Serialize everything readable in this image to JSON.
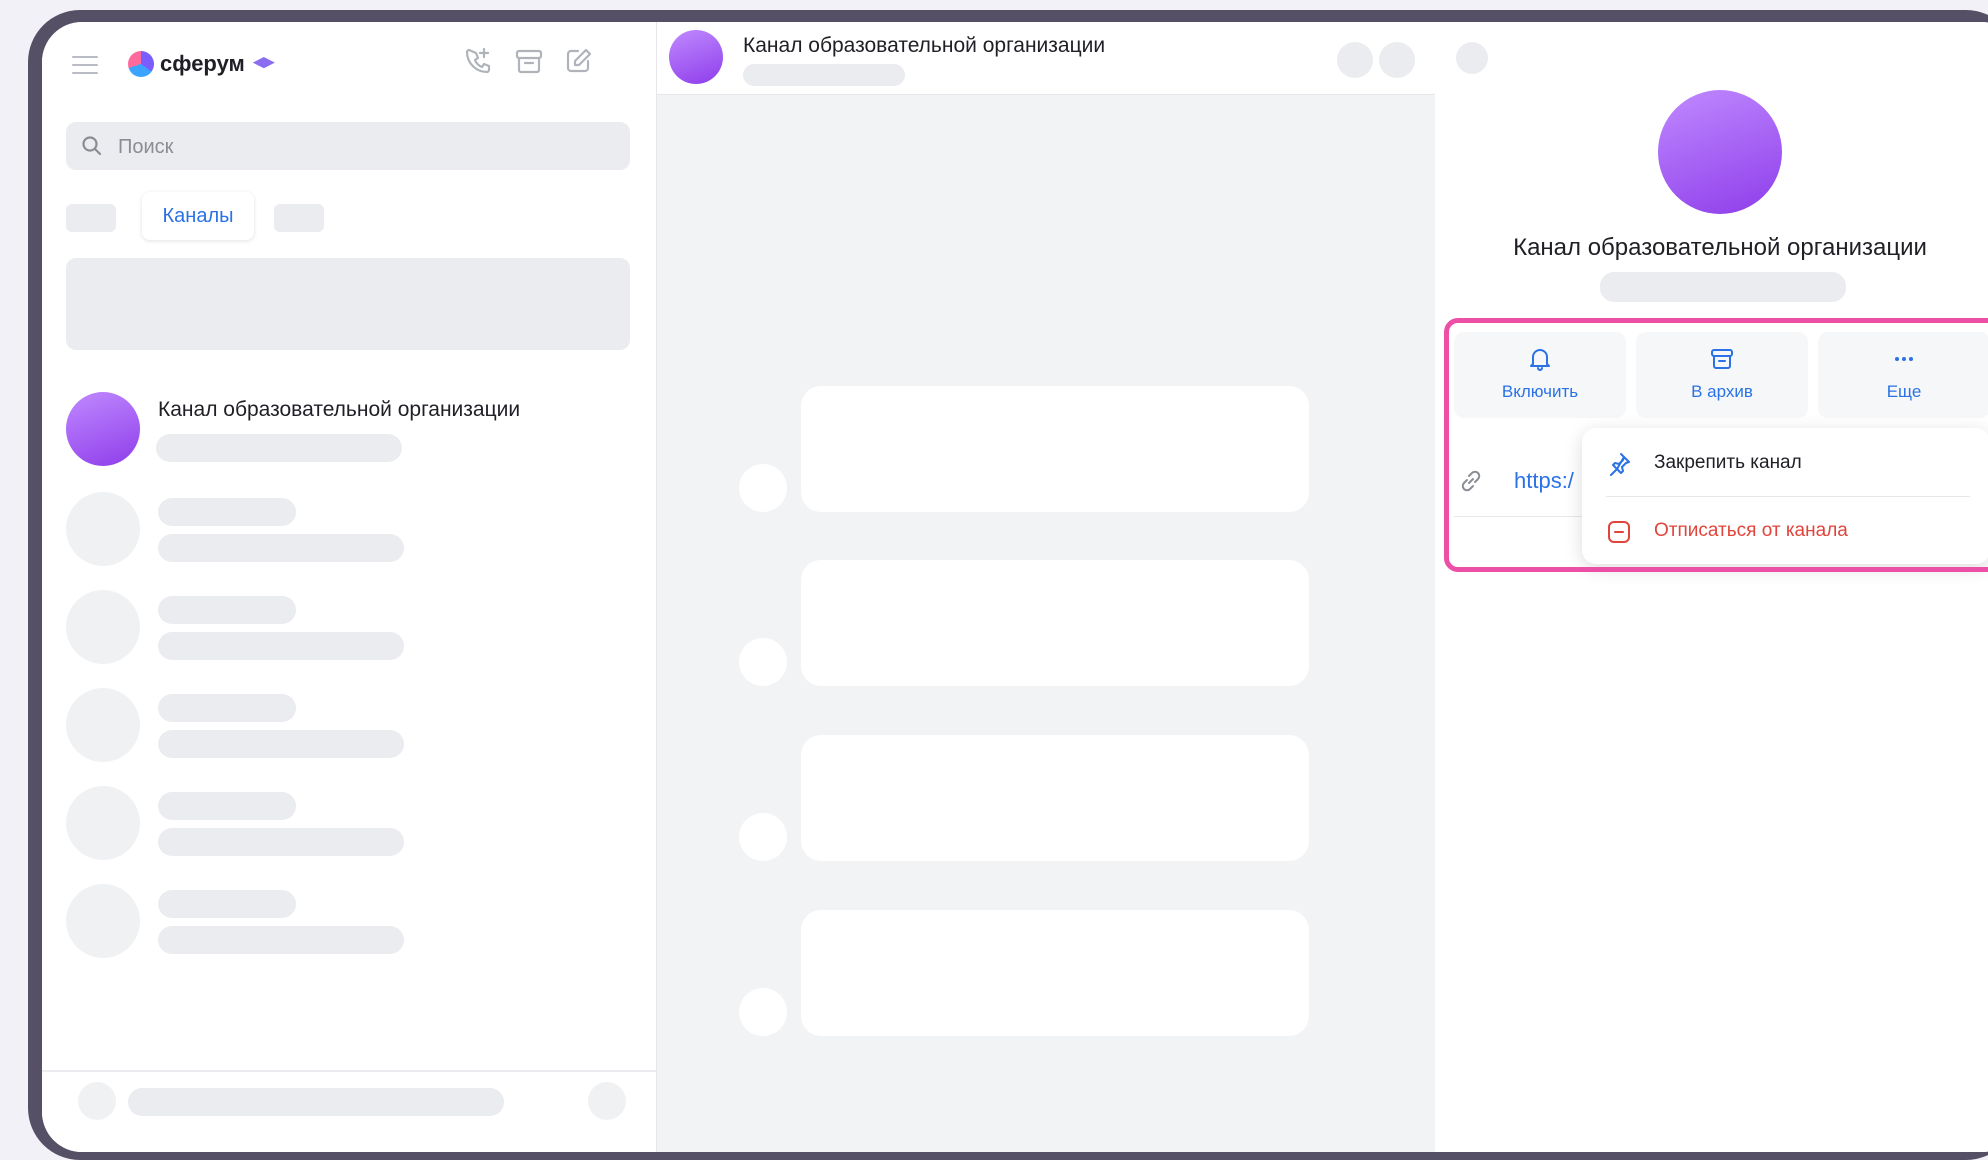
{
  "app": {
    "name": "сферум"
  },
  "left": {
    "search_placeholder": "Поиск",
    "active_tab": "Каналы",
    "chat": {
      "name": "Канал образовательной организации"
    }
  },
  "middle": {
    "header_title": "Канал образовательной организации"
  },
  "right": {
    "channel_title": "Канал образовательной организации",
    "actions": [
      {
        "label": "Включить",
        "icon": "bell-icon"
      },
      {
        "label": "В архив",
        "icon": "archive-icon"
      },
      {
        "label": "Еще",
        "icon": "more-icon"
      }
    ],
    "link_text": "https:/",
    "menu": [
      {
        "label": "Закрепить канал",
        "icon": "pin-icon",
        "color": "#1f1f26"
      },
      {
        "label": "Отписаться от канала",
        "icon": "minus-square-icon",
        "color": "#e0443a"
      }
    ]
  },
  "colors": {
    "accent": "#2a72e6",
    "highlight": "#ec4fa5",
    "danger": "#e0443a",
    "avatar": "#a45ff2"
  }
}
